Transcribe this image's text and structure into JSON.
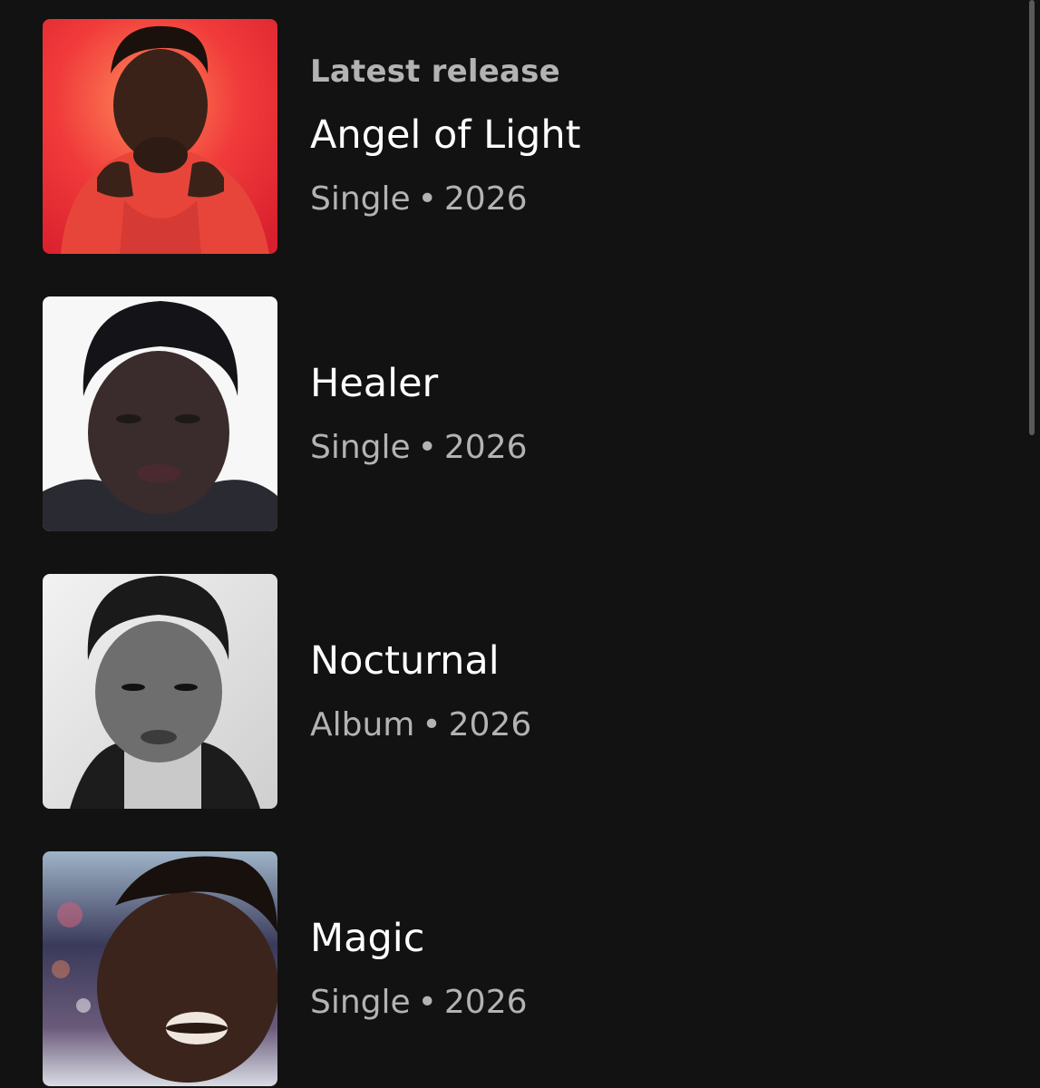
{
  "latest_label": "Latest release",
  "releases": [
    {
      "title": "Angel of Light",
      "type": "Single",
      "separator": "•",
      "year": "2026",
      "cover": "portrait-red-background"
    },
    {
      "title": "Healer",
      "type": "Single",
      "separator": "•",
      "year": "2026",
      "cover": "portrait-white-background"
    },
    {
      "title": "Nocturnal",
      "type": "Album",
      "separator": "•",
      "year": "2026",
      "cover": "portrait-black-and-white"
    },
    {
      "title": "Magic",
      "type": "Single",
      "separator": "•",
      "year": "2026",
      "cover": "portrait-galaxy-background"
    }
  ],
  "colors": {
    "background": "#121212",
    "title_text": "#ffffff",
    "secondary_text": "#b3b3b3",
    "scrollbar": "#5a5a5a"
  }
}
